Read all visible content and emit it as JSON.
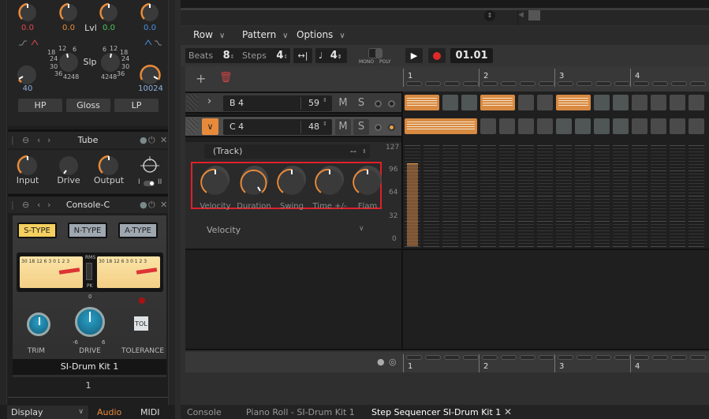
{
  "eq": {
    "band_values": [
      "0.0",
      "0.0",
      "0.0",
      "0.0"
    ],
    "band_colors": [
      "#e0484d",
      "#e88a3a",
      "#4cc35a",
      "#4a8fe0"
    ],
    "level_label": "Lvl",
    "slope_label": "Slp",
    "slope_ticks_left": [
      "18",
      "12",
      "6",
      "24",
      "30",
      "36",
      "42",
      "48"
    ],
    "slope_ticks_right": [
      "6",
      "12",
      "18",
      "24",
      "30",
      "36",
      "42",
      "48"
    ],
    "hp_freq": "40",
    "lp_freq": "10024",
    "buttons": [
      "HP",
      "Gloss",
      "LP"
    ]
  },
  "tube": {
    "title": "Tube",
    "knobs": [
      "Input",
      "Drive",
      "Output"
    ],
    "switch_labels": [
      "I",
      "II"
    ]
  },
  "console": {
    "title": "Console-C",
    "types": [
      "S-TYPE",
      "N-TYPE",
      "A-TYPE"
    ],
    "active_type": "S-TYPE",
    "vu_scale": "30 18 12 6 3 0 1 2 3",
    "meter_switch": [
      "RMS",
      "PK"
    ],
    "knobs": [
      "TRIM",
      "DRIVE",
      "TOLERANCE"
    ],
    "drive_ticks": [
      "0",
      "-6",
      "6"
    ],
    "tol_button": "TOL",
    "instrument": "SI-Drum Kit 1",
    "channel_number": "1"
  },
  "left_bottom": {
    "display_label": "Display",
    "audio_label": "Audio",
    "midi_label": "MIDI"
  },
  "menubar": {
    "items": [
      "Row",
      "Pattern",
      "Options"
    ]
  },
  "toolbar": {
    "beats_label": "Beats",
    "beats_value": "8",
    "steps_label": "Steps",
    "steps_value": "4",
    "note_value": "4",
    "mono_label": "MONO",
    "poly_label": "POLY",
    "position": "01.01"
  },
  "rows": [
    {
      "note": "B 4",
      "value": "59",
      "mute": "M",
      "solo": "S",
      "steps": [
        1,
        1,
        0,
        0,
        1,
        1,
        0,
        0,
        1,
        1,
        0,
        0,
        0,
        0,
        0,
        0
      ]
    },
    {
      "note": "C 4",
      "value": "48",
      "mute": "M",
      "solo": "S",
      "steps": [
        1,
        1,
        1,
        1,
        0,
        0,
        0,
        0,
        0,
        0,
        0,
        0,
        0,
        0,
        0,
        0
      ]
    }
  ],
  "ruler": [
    "1",
    "2",
    "3",
    "4"
  ],
  "lane": {
    "source": "(Track)",
    "source_value": "--",
    "knobs": [
      "Velocity",
      "Duration",
      "Swing",
      "Time +/-",
      "Flam"
    ],
    "selector": "Velocity",
    "scale": [
      "127",
      "96",
      "64",
      "32",
      "0"
    ],
    "velocity_first_step": 104
  },
  "tabs": [
    "Console",
    "Piano Roll - SI-Drum Kit 1",
    "Step Sequencer SI-Drum Kit 1"
  ],
  "active_tab": "Step Sequencer SI-Drum Kit 1",
  "colors": {
    "accent": "#e88a3a",
    "step_on": "#d88a42",
    "record": "#e02a2a",
    "highlight_box": "#e0202a"
  }
}
